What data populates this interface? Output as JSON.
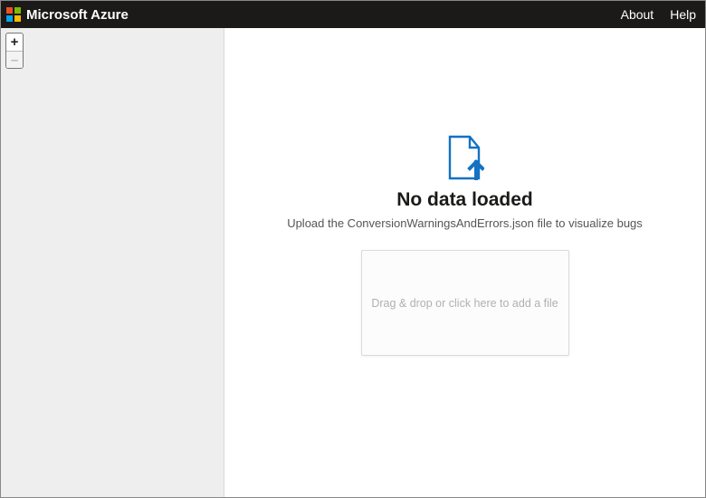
{
  "topbar": {
    "brand": "Microsoft Azure",
    "links": {
      "about": "About",
      "help": "Help"
    }
  },
  "sidebar": {
    "zoom_in": "+",
    "zoom_out": "–"
  },
  "empty_state": {
    "title": "No data loaded",
    "subtitle": "Upload the ConversionWarningsAndErrors.json file to visualize bugs",
    "dropzone_text": "Drag & drop or click here to add a file"
  },
  "colors": {
    "icon_blue": "#1372c3",
    "topbar_bg": "#1b1a19"
  }
}
